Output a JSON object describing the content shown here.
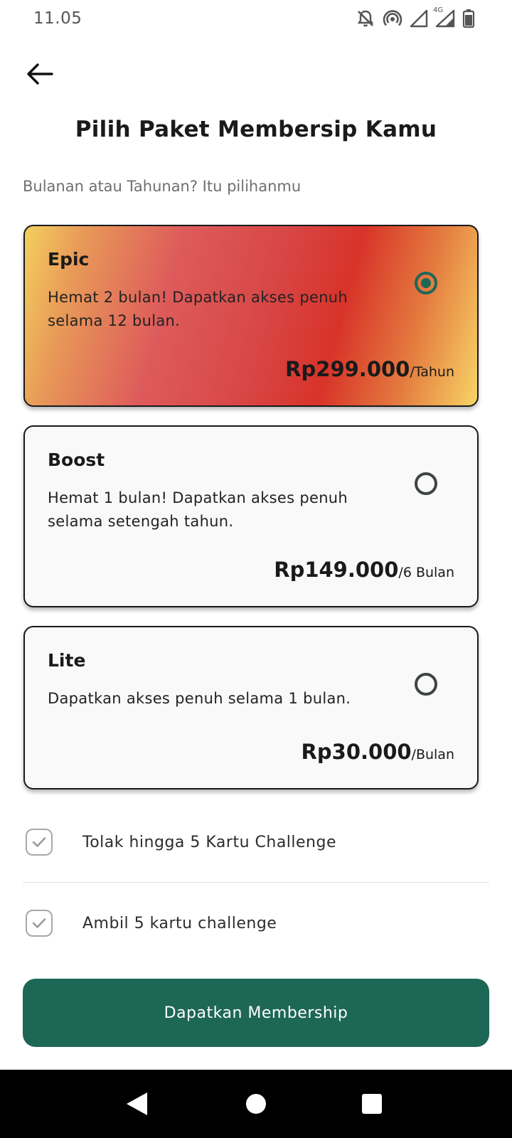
{
  "status_bar": {
    "time": "11.05",
    "icons": [
      "bell-off-icon",
      "hotspot-icon",
      "signal-icon",
      "signal-4g-icon",
      "battery-icon"
    ],
    "network_label": "4G"
  },
  "header": {
    "back_icon": "arrow-left-icon",
    "title": "Pilih Paket Membersip Kamu",
    "subtitle": "Bulanan atau Tahunan? Itu pilihanmu"
  },
  "plans": [
    {
      "name": "Epic",
      "description": "Hemat 2 bulan! Dapatkan akses penuh selama 12 bulan.",
      "price": "Rp299.000",
      "period": "/Tahun",
      "selected": true
    },
    {
      "name": "Boost",
      "description": "Hemat 1 bulan! Dapatkan akses penuh selama setengah tahun.",
      "price": "Rp149.000",
      "period": "/6 Bulan",
      "selected": false
    },
    {
      "name": "Lite",
      "description": "Dapatkan akses penuh selama 1 bulan.",
      "price": "Rp30.000",
      "period": "/Bulan",
      "selected": false
    }
  ],
  "features": [
    {
      "label": "Tolak hingga 5 Kartu Challenge",
      "icon": "checkbox-icon"
    },
    {
      "label": "Ambil 5 kartu challenge",
      "icon": "checkbox-icon"
    }
  ],
  "cta": {
    "label": "Dapatkan Membership"
  },
  "colors": {
    "primary": "#1d6757",
    "selected_gradient": [
      "#f5cf5e",
      "#de5b5b",
      "#d83329",
      "#f7d466"
    ],
    "card_background": "#f9f9f9"
  },
  "nav_bar": {
    "icons": [
      "nav-back-icon",
      "nav-home-icon",
      "nav-recents-icon"
    ]
  }
}
